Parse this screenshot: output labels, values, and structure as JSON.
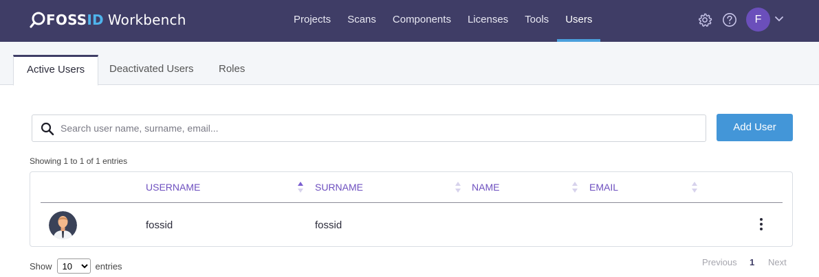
{
  "brand": {
    "fossid_part1": "FOSS",
    "fossid_part2": "ID",
    "product": "Workbench",
    "accent_color": "#4fb4ec"
  },
  "nav": {
    "items": [
      {
        "label": "Projects"
      },
      {
        "label": "Scans"
      },
      {
        "label": "Components"
      },
      {
        "label": "Licenses"
      },
      {
        "label": "Tools"
      },
      {
        "label": "Users",
        "active": true
      }
    ]
  },
  "header_icons": {
    "settings": "gear-icon",
    "help": "question-circle-icon",
    "user_initial": "F",
    "user_menu": "chevron-down-icon"
  },
  "tabs": [
    {
      "label": "Active Users",
      "active": true
    },
    {
      "label": "Deactivated Users"
    },
    {
      "label": "Roles"
    }
  ],
  "search": {
    "placeholder": "Search user name, surname, email...",
    "value": ""
  },
  "actions": {
    "add_user": "Add User"
  },
  "table_info": "Showing 1 to 1 of 1 entries",
  "table": {
    "columns": [
      "USERNAME",
      "SURNAME",
      "NAME",
      "EMAIL"
    ],
    "sorted_column": "USERNAME",
    "sort_direction": "ascending",
    "rows": [
      {
        "username": "fossid",
        "surname": "fossid",
        "name": "",
        "email": ""
      }
    ]
  },
  "length": {
    "show_label": "Show",
    "selected": "10",
    "entries_label": "entries"
  },
  "pagination": {
    "previous": "Previous",
    "current": "1",
    "next": "Next"
  },
  "colors": {
    "topbar": "#3f3d66",
    "nav_active_underline": "#4a9fdc",
    "primary_button": "#4396d8",
    "column_header": "#6d4fbf",
    "avatar": "#6b4fbb"
  }
}
